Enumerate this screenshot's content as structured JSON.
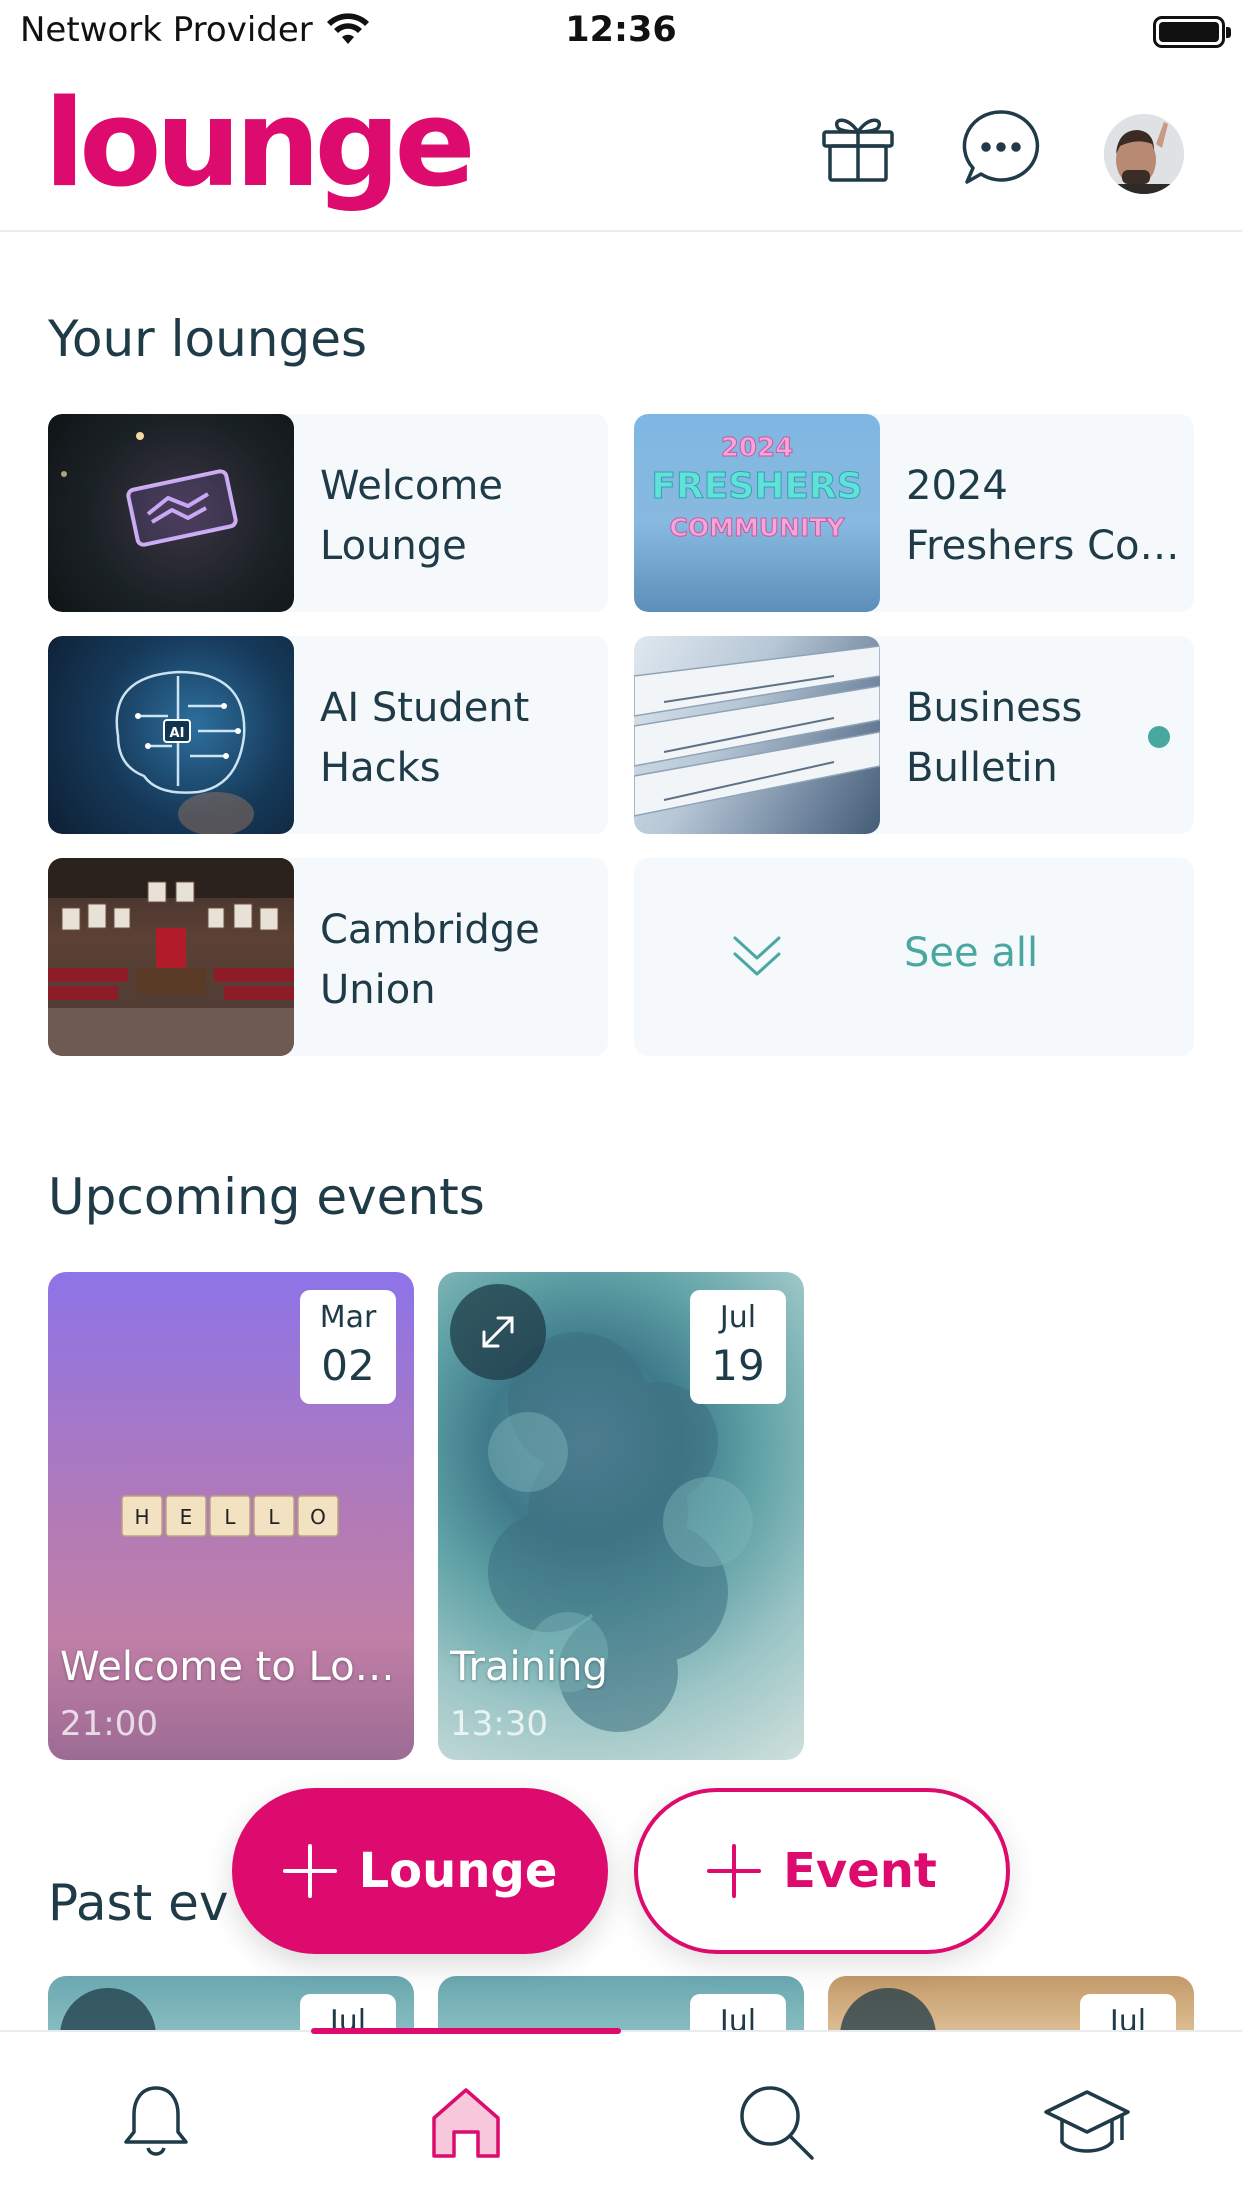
{
  "status_bar": {
    "carrier": "Network Provider",
    "time": "12:36"
  },
  "header": {
    "logo": "lounge",
    "icons": [
      "gift-icon",
      "chat-icon",
      "profile-avatar"
    ]
  },
  "your_lounges": {
    "title": "Your lounges",
    "items": [
      {
        "name": "Welcome Lounge"
      },
      {
        "name": "2024 Freshers Co…",
        "thumb_text": [
          "2024",
          "FRESHERS",
          "COMMUNITY"
        ]
      },
      {
        "name": "AI Student Hacks",
        "thumb_text": "AI"
      },
      {
        "name": "Business Bulletin",
        "unread": true
      },
      {
        "name": "Cambridge Union"
      }
    ],
    "see_all": "See all"
  },
  "upcoming_events": {
    "title": "Upcoming events",
    "items": [
      {
        "title": "Welcome to Lo…",
        "time": "21:00",
        "month": "Mar",
        "day": "02",
        "tiles": [
          "H",
          "E",
          "L",
          "L",
          "O"
        ]
      },
      {
        "title": "Training",
        "time": "13:30",
        "month": "Jul",
        "day": "19"
      }
    ]
  },
  "past_events": {
    "title": "Past ev",
    "items": [
      {
        "month": "Jul"
      },
      {
        "month": "Jul"
      },
      {
        "month": "Jul"
      }
    ]
  },
  "fab": {
    "lounge": "Lounge",
    "event": "Event"
  },
  "bottom_nav": {
    "items": [
      "bell-icon",
      "home-icon",
      "search-icon",
      "graduation-cap-icon"
    ],
    "active": "home-icon"
  },
  "colors": {
    "brand": "#de0b6f",
    "accent": "#48a8a0",
    "text": "#1f3b47"
  }
}
